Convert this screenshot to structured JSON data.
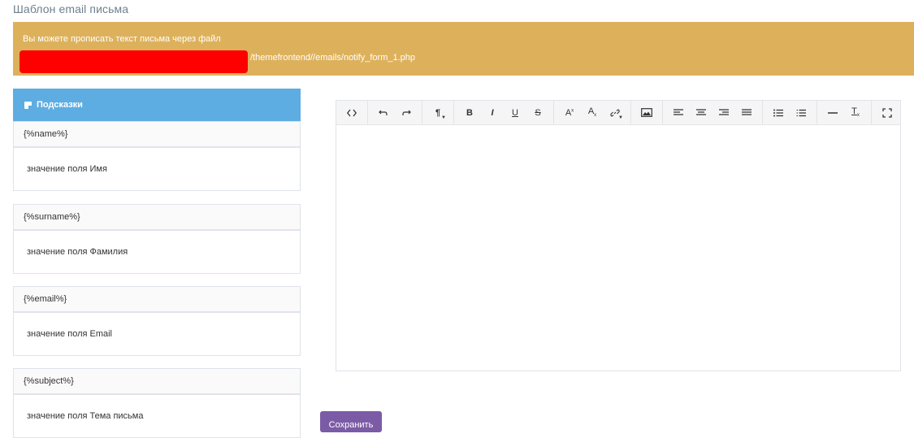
{
  "page": {
    "title": "Шаблон email письма"
  },
  "notice": {
    "text": "Вы можете прописать текст письма через файл",
    "path": "/themefrontend//emails/notify_form_1.php",
    "redaction_color": "#ff0000",
    "background": "#ddb15c"
  },
  "hints": {
    "header": "Подсказки",
    "items": [
      {
        "code": "{%name%}",
        "desc": "значение поля Имя"
      },
      {
        "code": "{%surname%}",
        "desc": "значение поля Фамилия"
      },
      {
        "code": "{%email%}",
        "desc": "значение поля Email"
      },
      {
        "code": "{%subject%}",
        "desc": "значение поля Тема письма"
      }
    ]
  },
  "toolbar": {
    "buttons": [
      {
        "name": "code-view",
        "icon": "code-icon"
      },
      {
        "name": "undo",
        "icon": "undo-icon"
      },
      {
        "name": "redo",
        "icon": "redo-icon"
      },
      {
        "name": "paragraph-format",
        "icon": "pilcrow-icon"
      },
      {
        "name": "bold",
        "icon": "bold-icon"
      },
      {
        "name": "italic",
        "icon": "italic-icon"
      },
      {
        "name": "underline",
        "icon": "underline-icon"
      },
      {
        "name": "strikethrough",
        "icon": "strikethrough-icon"
      },
      {
        "name": "superscript",
        "icon": "superscript-icon"
      },
      {
        "name": "subscript",
        "icon": "subscript-icon"
      },
      {
        "name": "link",
        "icon": "link-icon"
      },
      {
        "name": "image",
        "icon": "image-icon"
      },
      {
        "name": "align-left",
        "icon": "align-left-icon"
      },
      {
        "name": "align-center",
        "icon": "align-center-icon"
      },
      {
        "name": "align-right",
        "icon": "align-right-icon"
      },
      {
        "name": "align-justify",
        "icon": "align-justify-icon"
      },
      {
        "name": "bullet-list",
        "icon": "bullet-list-icon"
      },
      {
        "name": "numbered-list",
        "icon": "numbered-list-icon"
      },
      {
        "name": "horizontal-rule",
        "icon": "horizontal-rule-icon"
      },
      {
        "name": "clear-format",
        "icon": "clear-format-icon"
      },
      {
        "name": "fullscreen",
        "icon": "fullscreen-icon"
      }
    ]
  },
  "save": {
    "label": "Сохранить",
    "color": "#7c5ba6"
  }
}
